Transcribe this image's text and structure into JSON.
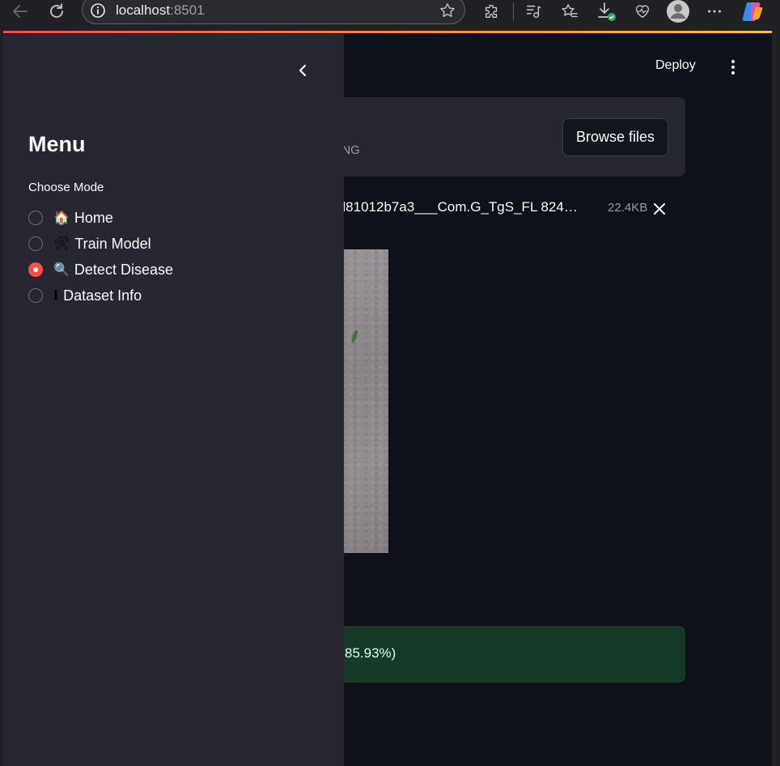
{
  "browser": {
    "address_host": "localhost",
    "address_port": ":8501"
  },
  "app": {
    "deploy_label": "Deploy",
    "uploader": {
      "limit_text": ", PNG",
      "browse_label": "Browse files"
    },
    "file": {
      "name": "fd81012b7a3___Com.G_TgS_FL 824…",
      "size": "22.4KB"
    },
    "result_text": "85.93%)"
  },
  "sidebar": {
    "title": "Menu",
    "mode_label": "Choose Mode",
    "modes": [
      {
        "emoji": "🏠",
        "label": "Home",
        "selected": false
      },
      {
        "emoji": "🛠",
        "label": "Train Model",
        "selected": false
      },
      {
        "emoji": "🔍",
        "label": "Detect Disease",
        "selected": true
      },
      {
        "emoji": "ℹ",
        "label": "Dataset Info",
        "selected": false
      }
    ]
  },
  "colors": {
    "accent": "#ff4b4b",
    "sidebar_bg": "#262730",
    "app_bg": "#0e1117",
    "success_bg": "#173928"
  }
}
